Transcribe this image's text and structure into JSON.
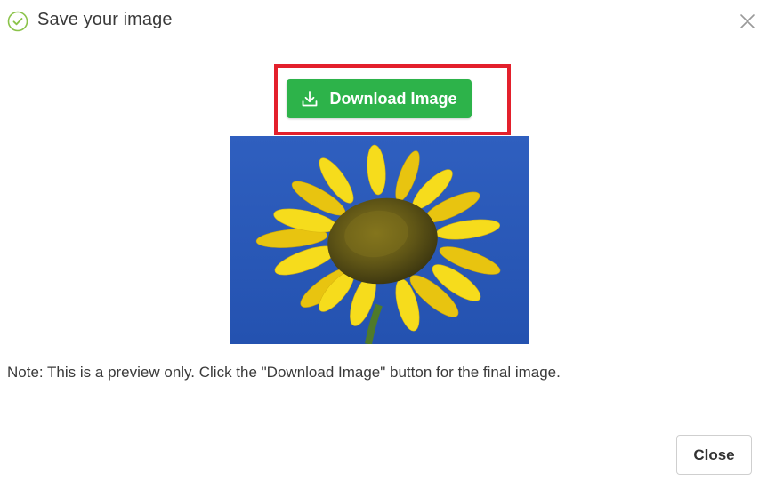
{
  "dialog": {
    "title": "Save your image",
    "title_icon": "check-circle-icon",
    "close_icon": "close-icon"
  },
  "download": {
    "label": "Download Image",
    "icon": "download-icon",
    "button_color": "#2db34a",
    "highlight_color": "#e3202c"
  },
  "preview": {
    "description_icon": "sunflower-preview-image"
  },
  "note": "Note: This is a preview only. Click the \"Download Image\" button for the final image.",
  "footer": {
    "close_label": "Close"
  }
}
